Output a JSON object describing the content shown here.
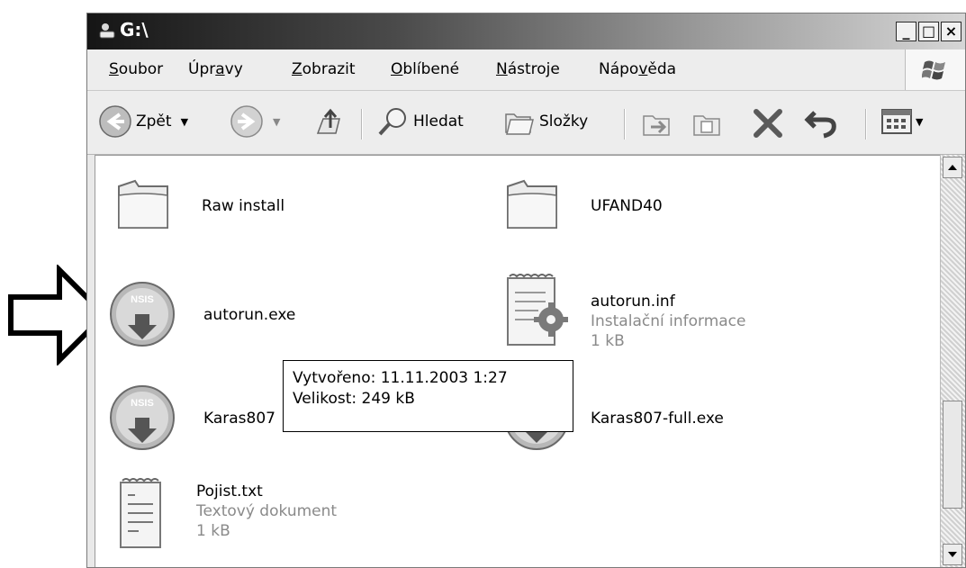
{
  "window": {
    "title": "G:\\",
    "buttons": {
      "minimize": "_",
      "maximize": "□",
      "close": "×"
    }
  },
  "menu": [
    {
      "pre": "",
      "ul": "S",
      "post": "oubor"
    },
    {
      "pre": "Úpr",
      "ul": "a",
      "post": "vy"
    },
    {
      "pre": "",
      "ul": "Z",
      "post": "obrazit"
    },
    {
      "pre": "",
      "ul": "O",
      "post": "blíbené"
    },
    {
      "pre": "",
      "ul": "N",
      "post": "ástroje"
    },
    {
      "pre": "Nápo",
      "ul": "v",
      "post": "ěda"
    }
  ],
  "toolbar": {
    "back_label": "Zpět",
    "search_label": "Hledat",
    "folders_label": "Složky"
  },
  "files": [
    {
      "name": "Raw install",
      "icon": "folder-icon"
    },
    {
      "name": "UFAND40",
      "icon": "folder-icon"
    },
    {
      "name": "autorun.exe",
      "icon": "installer-icon"
    },
    {
      "name": "autorun.inf",
      "type": "Instalační informace",
      "size": "1 kB",
      "icon": "setup-info-icon"
    },
    {
      "name": "Karas807",
      "icon": "installer-icon"
    },
    {
      "name": "Karas807-full.exe",
      "icon": "installer-icon"
    },
    {
      "name": "Pojist.txt",
      "type": "Textový dokument",
      "size": "1 kB",
      "icon": "text-document-icon"
    }
  ],
  "tooltip": {
    "line1": "Vytvořeno: 11.11.2003 1:27",
    "line2": "Velikost: 249 kB"
  }
}
